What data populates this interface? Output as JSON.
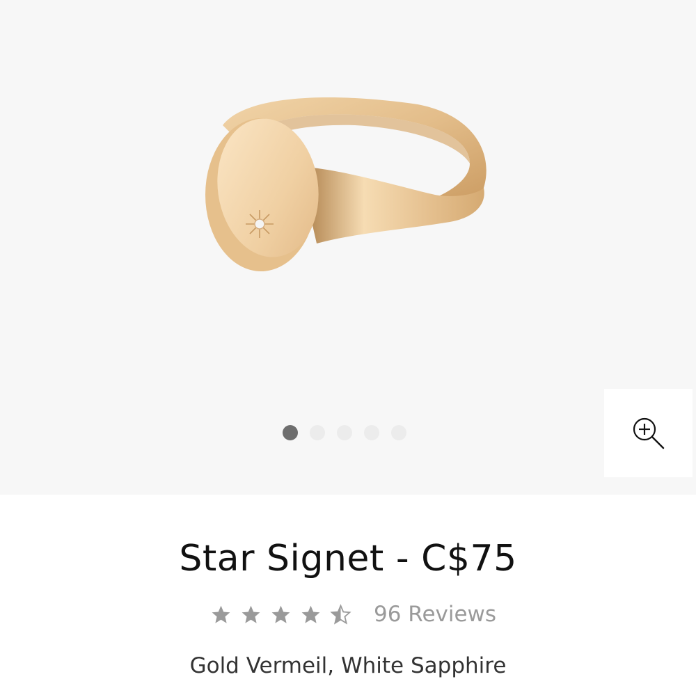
{
  "gallery": {
    "image_alt": "Star Signet ring in gold vermeil with white sapphire",
    "slide_count": 5,
    "active_slide": 1,
    "zoom_icon": "zoom-in-icon"
  },
  "product": {
    "title": "Star Signet - C$75",
    "rating": 4.5,
    "rating_max": 5,
    "reviews_label": "96 Reviews",
    "material": "Gold Vermeil, White Sapphire"
  },
  "colors": {
    "gallery_bg": "#f7f7f7",
    "dot_active": "#6e6e6e",
    "dot_inactive": "#ececec",
    "star_color": "#9a9a9a",
    "gold_light": "#f3d9b1",
    "gold_mid": "#e2bd88",
    "gold_dark": "#c99a62"
  }
}
